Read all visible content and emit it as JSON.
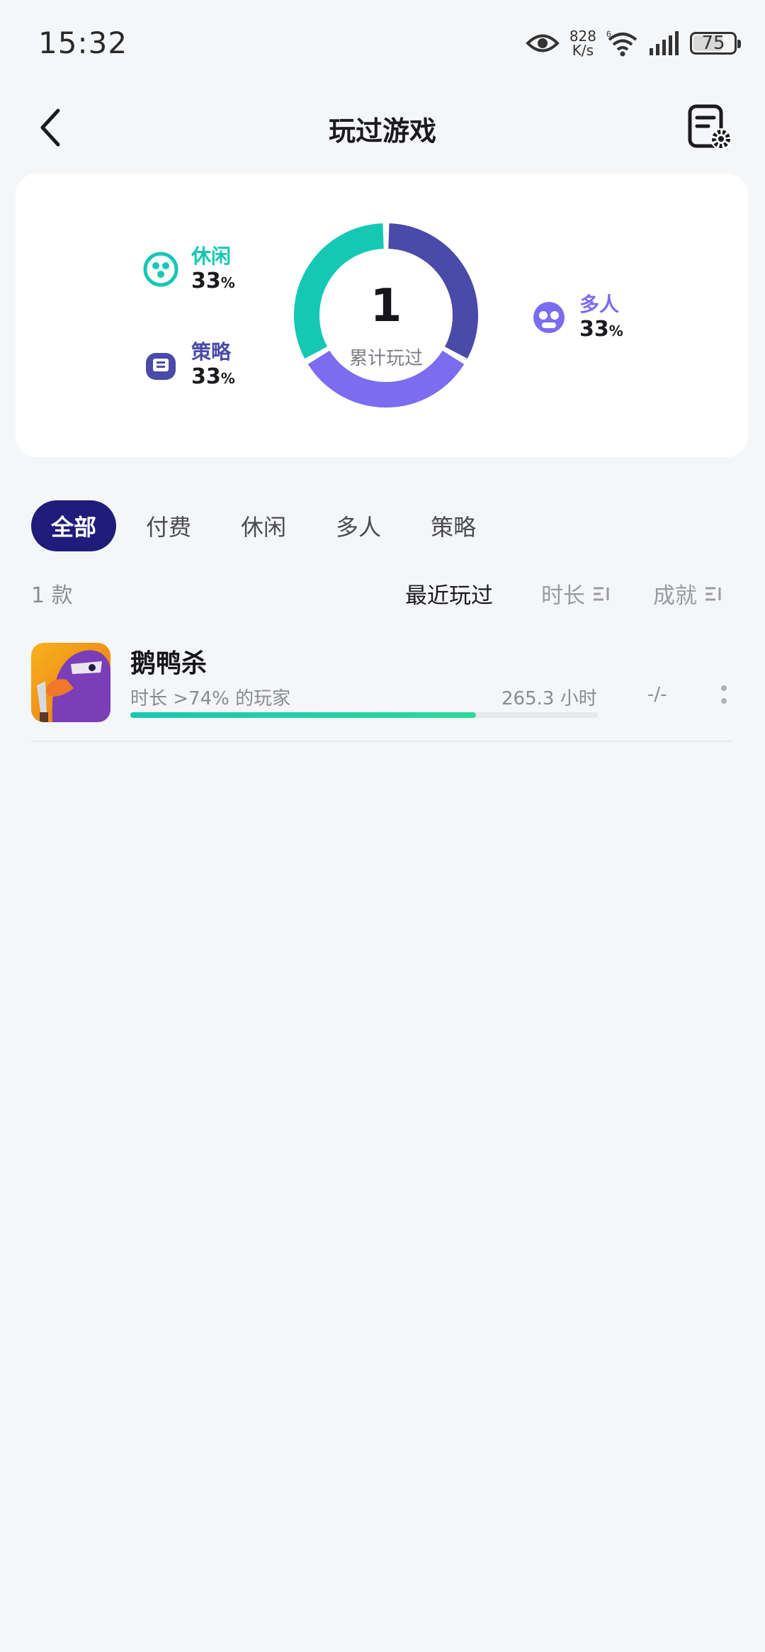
{
  "status_bar": {
    "time": "15:32",
    "net_speed_value": "828",
    "net_speed_unit": "K/s",
    "wifi_badge": "6",
    "battery": "75",
    "battery_level": 0.75,
    "icons": [
      "eye-icon",
      "wifi-icon",
      "signal-icon",
      "battery-icon"
    ]
  },
  "header": {
    "title": "玩过游戏",
    "back_icon": "chevron-left-icon",
    "settings_icon": "list-settings-icon"
  },
  "summary": {
    "total": "1",
    "total_label": "累计玩过",
    "categories": [
      {
        "name": "休闲",
        "pct": "33",
        "color": "#14c8b4",
        "icon": "casual-icon"
      },
      {
        "name": "策略",
        "pct": "33",
        "color": "#4a4aa8",
        "icon": "strategy-icon"
      },
      {
        "name": "多人",
        "pct": "33",
        "color": "#7b6cf0",
        "icon": "multiplayer-icon"
      }
    ],
    "pct_unit": "%"
  },
  "tabs": [
    "全部",
    "付费",
    "休闲",
    "多人",
    "策略"
  ],
  "active_tab": "全部",
  "list": {
    "count": "1 款",
    "sort_options": [
      "最近玩过",
      "时长",
      "成就"
    ],
    "active_sort": "最近玩过"
  },
  "games": [
    {
      "name": "鹅鸭杀",
      "subtitle": "时长 >74% 的玩家",
      "progress": 0.74,
      "hours": "265.3 小时",
      "achievements": "-/-"
    }
  ],
  "colors": {
    "accent": "#1f1c7c",
    "casual": "#14c8b4",
    "strategy": "#4a4aa8",
    "multiplayer": "#7b6cf0",
    "background": "#f5f6f8"
  }
}
